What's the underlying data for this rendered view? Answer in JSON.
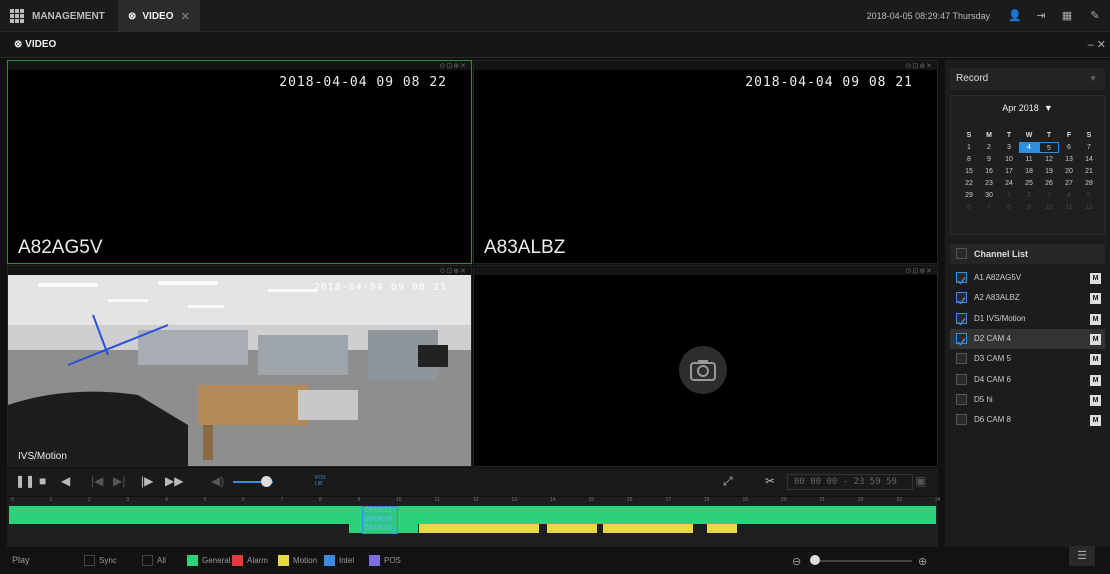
{
  "tabs": {
    "management": "MANAGEMENT",
    "video": "VIDEO"
  },
  "header": {
    "datetime": "2018-04-05 08:29:47 Thursday"
  },
  "subheader": {
    "title": "VIDEO"
  },
  "panes": [
    {
      "timestamp": "2018-04-04 09 08 22",
      "channel": "A82AG5V"
    },
    {
      "timestamp": "2018-04-04 09 08 21",
      "channel": "A83ALBZ"
    },
    {
      "timestamp": "2018-04-04 09 08 21",
      "channel": "IVS/Motion"
    },
    {
      "timestamp": "",
      "channel": ""
    }
  ],
  "controls": {
    "time_range": "00 00 00  -  23 59 59",
    "pos_label": "POS\nLIB"
  },
  "timeline": {
    "ticks": [
      "0",
      "1",
      "2",
      "3",
      "4",
      "5",
      "6",
      "7",
      "8",
      "9",
      "10",
      "11",
      "12",
      "13",
      "14",
      "15",
      "16",
      "17",
      "18",
      "19",
      "20",
      "21",
      "22",
      "23",
      "24"
    ],
    "cursor_times": [
      "09:08:21",
      "09:08:20",
      "09:08:20"
    ]
  },
  "footer": {
    "play": "Play",
    "sync": "Sync",
    "all": "All",
    "general": "General",
    "alarm": "Alarm",
    "motion": "Motion",
    "intel": "Intel",
    "pos": "POS"
  },
  "record_type": "Record",
  "calendar": {
    "month": "Apr 2018",
    "dow": [
      "S",
      "M",
      "T",
      "W",
      "T",
      "F",
      "S"
    ],
    "days": [
      [
        "1",
        "2",
        "3",
        "4",
        "5",
        "6",
        "7"
      ],
      [
        "8",
        "9",
        "10",
        "11",
        "12",
        "13",
        "14"
      ],
      [
        "15",
        "16",
        "17",
        "18",
        "19",
        "20",
        "21"
      ],
      [
        "22",
        "23",
        "24",
        "25",
        "26",
        "27",
        "28"
      ],
      [
        "29",
        "30",
        "1",
        "2",
        "3",
        "4",
        "5"
      ],
      [
        "6",
        "7",
        "8",
        "9",
        "10",
        "11",
        "12"
      ]
    ]
  },
  "channel_list": {
    "header": "Channel List",
    "items": [
      {
        "label": "A1 A82AG5V",
        "checked": true
      },
      {
        "label": "A2 A83ALBZ",
        "checked": true
      },
      {
        "label": "D1 IVS/Motion",
        "checked": true
      },
      {
        "label": "D2 CAM 4",
        "checked": true
      },
      {
        "label": "D3 CAM 5",
        "checked": false
      },
      {
        "label": "D4 CAM 6",
        "checked": false
      },
      {
        "label": "D5 hi",
        "checked": false
      },
      {
        "label": "D6 CAM 8",
        "checked": false
      }
    ],
    "m_label": "M"
  },
  "colors": {
    "general": "#2bd27a",
    "alarm": "#e03c3c",
    "motion": "#e7d845",
    "intel": "#3b8be0",
    "pos": "#7d6ee0",
    "accent": "#2c8fe0"
  }
}
